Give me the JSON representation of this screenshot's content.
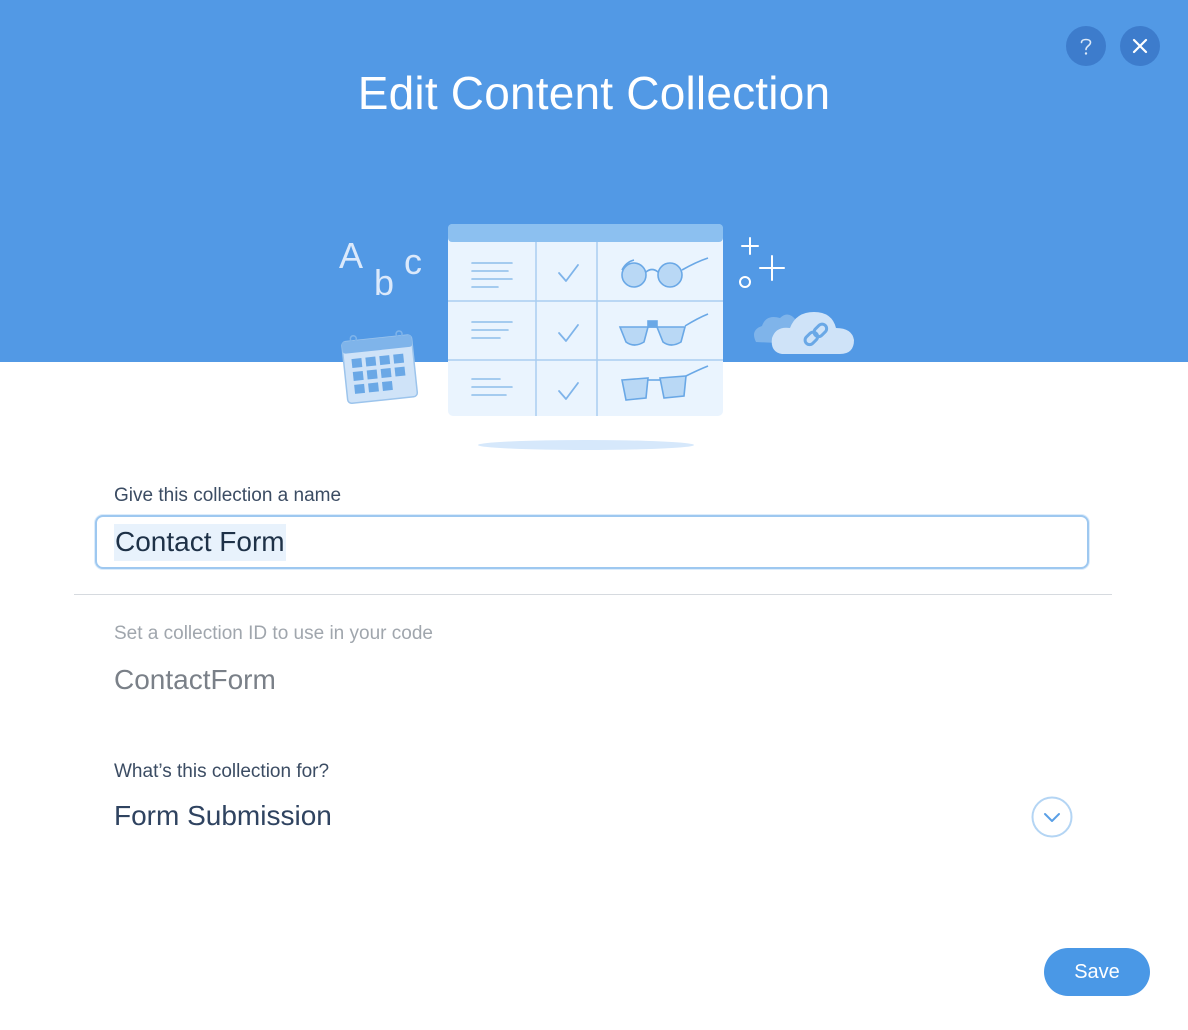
{
  "dialog": {
    "title": "Edit Content Collection",
    "help_icon": "question-mark-icon",
    "close_icon": "close-x-icon"
  },
  "illustration": {
    "letters": [
      "A",
      "b",
      "c"
    ],
    "icons": [
      "calendar-icon",
      "table-icon",
      "cloud-link-icon",
      "plus-icon"
    ]
  },
  "name_field": {
    "label": "Give this collection a name",
    "value": "Contact Form"
  },
  "id_field": {
    "label": "Set a collection ID to use in your code",
    "value": "ContactForm"
  },
  "purpose_field": {
    "label": "What’s this collection for?",
    "value": "Form Submission",
    "icon": "chevron-down-icon"
  },
  "footer": {
    "save_label": "Save"
  },
  "colors": {
    "header": "#5299e5",
    "accent": "#4a98e6",
    "header_button": "#3d7ccc"
  }
}
